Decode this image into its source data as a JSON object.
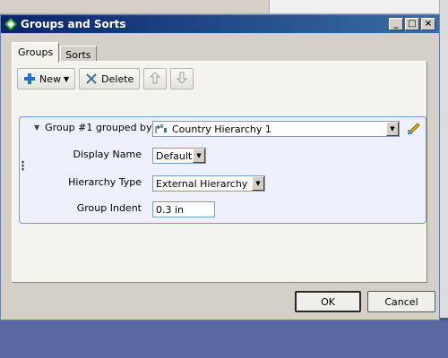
{
  "window": {
    "title": "Groups and Sorts",
    "controls": [
      "_",
      "□",
      "×"
    ]
  },
  "tabs": [
    {
      "label": "Groups",
      "active": true
    },
    {
      "label": "Sorts",
      "active": false
    }
  ],
  "toolbar": {
    "new_label": "New",
    "delete_label": "Delete"
  },
  "group": {
    "header_label": "Group #1 grouped by:",
    "grouped_by_value": "Country Hierarchy 1",
    "display_name_label": "Display Name",
    "display_name_value": "Default",
    "hierarchy_type_label": "Hierarchy Type",
    "hierarchy_type_value": "External Hierarchy",
    "group_indent_label": "Group Indent",
    "group_indent_value": "0.3 in"
  },
  "footer": {
    "ok_label": "OK",
    "cancel_label": "Cancel"
  },
  "colors": {
    "titlebar_start": "#0a246a",
    "titlebar_end": "#3a6ea5",
    "group_border": "#7a96df",
    "group_bg": "#eef1fb",
    "new_icon": "#1e6fd9"
  },
  "icons": [
    "app-diamond-icon",
    "plus-icon",
    "delete-x-icon",
    "arrow-up-icon",
    "arrow-down-icon",
    "hierarchy-icon",
    "edit-formula-icon",
    "expand-triangle-icon",
    "chevron-down-icon"
  ]
}
